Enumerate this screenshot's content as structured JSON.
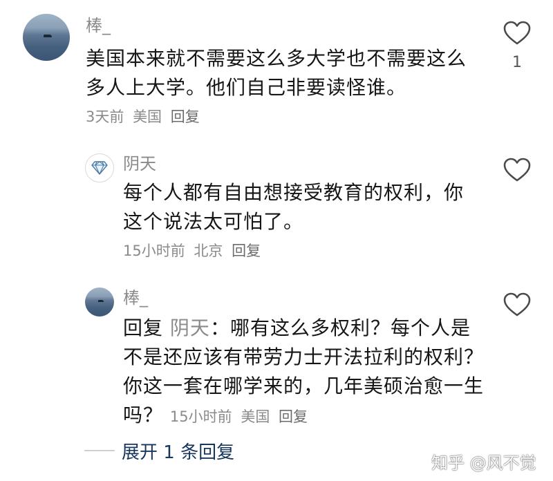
{
  "comments": [
    {
      "author": "棒_",
      "text": "美国本来就不需要这么多大学也不需要这么多人上大学。他们自己非要读怪谁。",
      "time": "3天前",
      "location": "美国",
      "reply_label": "回复",
      "likes": "1"
    }
  ],
  "replies": [
    {
      "author": "阴天",
      "text": "每个人都有自由想接受教育的权利，你这个说法太可怕了。",
      "time": "15小时前",
      "location": "北京",
      "reply_label": "回复"
    },
    {
      "author": "棒_",
      "reply_prefix": "回复",
      "reply_to": "阴天",
      "text": "：哪有这么多权利？每个人是不是还应该有带劳力士开法拉利的权利？你这一套在哪学来的，几年美硕治愈一生吗？",
      "time": "15小时前",
      "location": "美国",
      "reply_label": "回复"
    }
  ],
  "expand_label": "展开 1 条回复",
  "watermark": "知乎 @风不觉",
  "icons": {
    "like": "heart-outline-icon",
    "badge": "diamond-icon",
    "avatar": "sea-photo"
  },
  "colors": {
    "text": "#161616",
    "muted": "#8a8a8a",
    "link": "#17365e"
  }
}
